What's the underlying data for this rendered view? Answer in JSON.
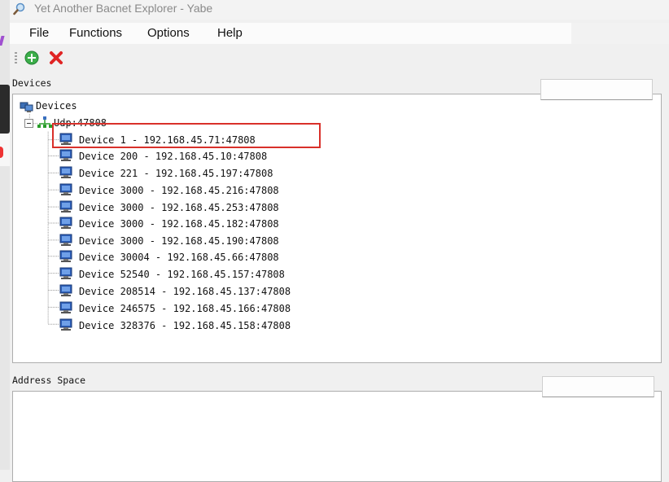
{
  "window": {
    "title": "Yet Another Bacnet Explorer - Yabe",
    "title_icon": "magnifier-icon"
  },
  "menu": [
    "File",
    "Functions",
    "Options",
    "Help"
  ],
  "toolbar": {
    "buttons": [
      {
        "icon": "add-green-icon",
        "color": "#2ea043"
      },
      {
        "icon": "delete-red-x-icon",
        "color": "#e02424"
      }
    ]
  },
  "devices_panel": {
    "label": "Devices",
    "root": "Devices",
    "network": "Udp:47808",
    "devices": [
      "Device 1 - 192.168.45.71:47808",
      "Device 200 - 192.168.45.10:47808",
      "Device 221 - 192.168.45.197:47808",
      "Device 3000 - 192.168.45.216:47808",
      "Device 3000 - 192.168.45.253:47808",
      "Device 3000 - 192.168.45.182:47808",
      "Device 3000 - 192.168.45.190:47808",
      "Device 30004 - 192.168.45.66:47808",
      "Device 52540 - 192.168.45.157:47808",
      "Device 208514 - 192.168.45.137:47808",
      "Device 246575 - 192.168.45.166:47808",
      "Device 328376 - 192.168.45.158:47808"
    ]
  },
  "address_panel": {
    "label": "Address Space"
  },
  "colors": {
    "highlight": "#d9302a",
    "network_green": "#2a9d2a"
  }
}
